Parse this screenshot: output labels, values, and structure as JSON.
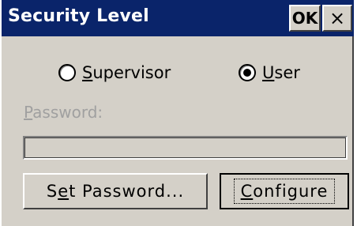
{
  "window": {
    "title": "Security Level",
    "ok_label": "OK",
    "close_label": "×"
  },
  "radios": [
    {
      "label_first": "S",
      "label_rest": "upervisor",
      "selected": false
    },
    {
      "label_first": "U",
      "label_rest": "ser",
      "selected": true
    }
  ],
  "password": {
    "label_first": "P",
    "label_rest": "assword:",
    "value": ""
  },
  "buttons": {
    "set_password_a": "S",
    "set_password_u": "e",
    "set_password_b": "t Password...",
    "configure_u": "C",
    "configure_rest": "onfigure"
  },
  "colors": {
    "titlebar": "#0a246a",
    "face": "#d4d0c8",
    "disabled_text": "#a0a0a0"
  }
}
